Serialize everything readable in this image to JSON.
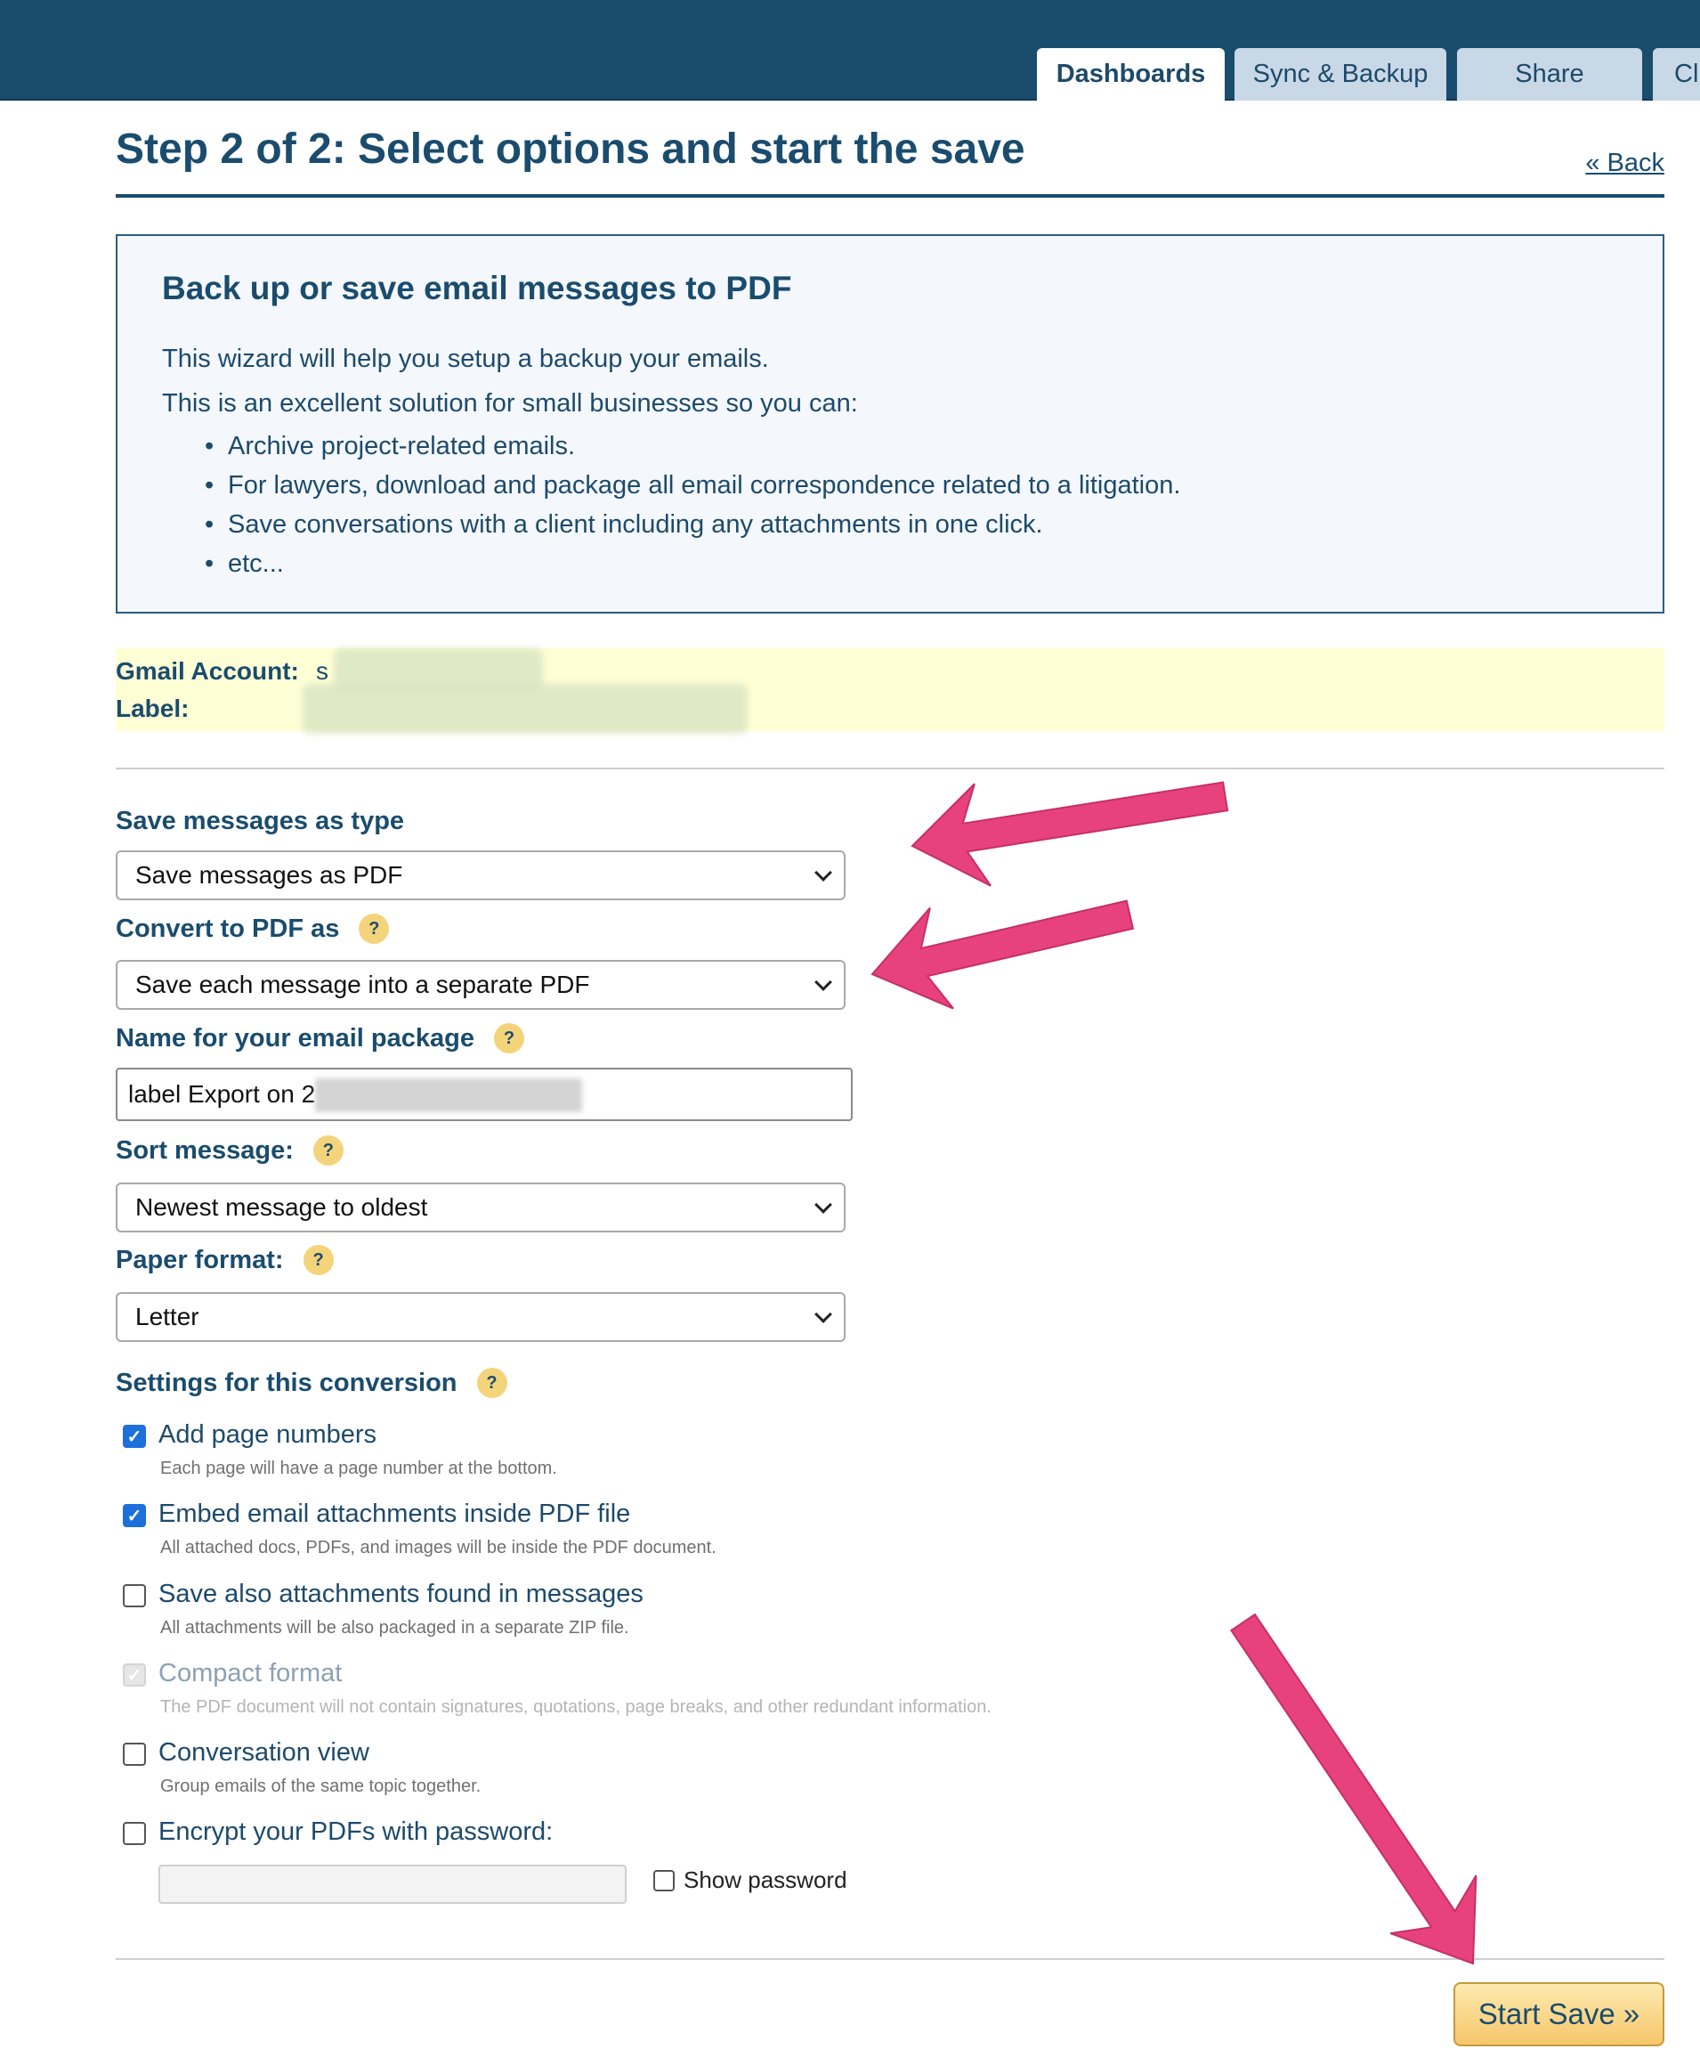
{
  "tabs": [
    {
      "label": "Dashboards",
      "active": true
    },
    {
      "label": "Sync & Backup",
      "active": false
    },
    {
      "label": "Share",
      "active": false
    },
    {
      "label": "Cl",
      "active": false
    }
  ],
  "page": {
    "title": "Step 2 of 2: Select options and start the save",
    "back_link": "« Back"
  },
  "info_box": {
    "title": "Back up or save email messages to PDF",
    "paragraph1": "This wizard will help you setup a backup your emails.",
    "paragraph2": "This is an excellent solution for small businesses so you can:",
    "bullets": [
      "Archive project-related emails.",
      "For lawyers, download and package all email correspondence related to a litigation.",
      "Save conversations with a client including any attachments in one click.",
      "etc..."
    ]
  },
  "account": {
    "gmail_label": "Gmail Account:",
    "gmail_value": "s",
    "label_label": "Label:"
  },
  "form": {
    "save_type": {
      "label": "Save messages as type",
      "value": "Save messages as PDF"
    },
    "convert_as": {
      "label": "Convert to PDF as",
      "value": "Save each message into a separate PDF"
    },
    "package_name": {
      "label": "Name for your email package",
      "value": "label Export on 2"
    },
    "sort": {
      "label": "Sort message:",
      "value": "Newest message to oldest"
    },
    "paper": {
      "label": "Paper format:",
      "value": "Letter"
    },
    "settings_label": "Settings for this conversion",
    "help_glyph": "?"
  },
  "options": [
    {
      "label": "Add page numbers",
      "desc": "Each page will have a page number at the bottom.",
      "checked": true,
      "disabled": false
    },
    {
      "label": "Embed email attachments inside PDF file",
      "desc": "All attached docs, PDFs, and images will be inside the PDF document.",
      "checked": true,
      "disabled": false
    },
    {
      "label": "Save also attachments found in messages",
      "desc": "All attachments will be also packaged in a separate ZIP file.",
      "checked": false,
      "disabled": false
    },
    {
      "label": "Compact format",
      "desc": "The PDF document will not contain signatures, quotations, page breaks, and other redundant information.",
      "checked": true,
      "disabled": true
    },
    {
      "label": "Conversation view",
      "desc": "Group emails of the same topic together.",
      "checked": false,
      "disabled": false
    },
    {
      "label": "Encrypt your PDFs with password:",
      "desc": "",
      "checked": false,
      "disabled": false
    }
  ],
  "password": {
    "show_label": "Show password",
    "value": ""
  },
  "start_button": "Start Save  »",
  "colors": {
    "header": "#1a4c6e",
    "accent_arrow": "#e8427c",
    "highlight": "#ffffd6",
    "button": "#f6c66a"
  },
  "icons": {
    "help": "question-circle-icon",
    "check": "checkmark-icon",
    "dropdown": "chevron-down-icon"
  }
}
